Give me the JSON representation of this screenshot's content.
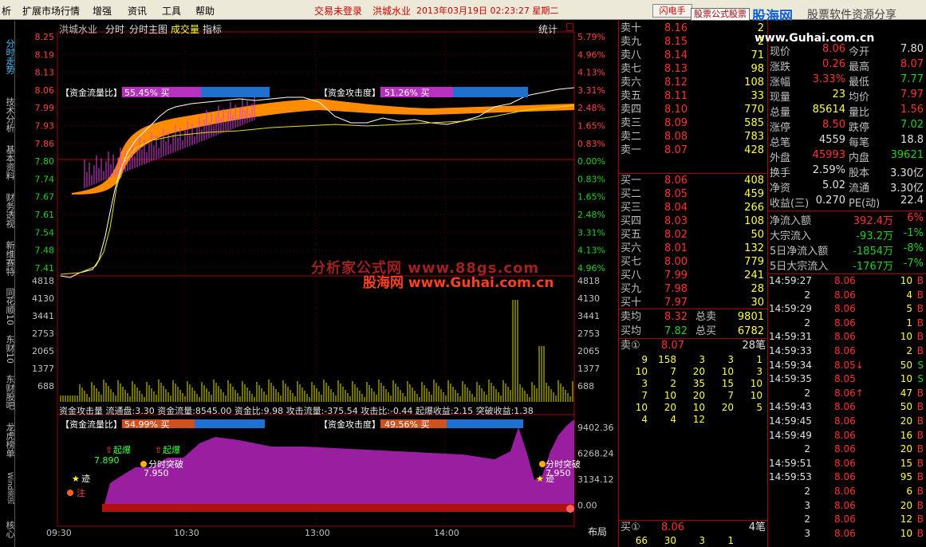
{
  "menu": {
    "items": [
      "析",
      "扩展市场行情",
      "增强",
      "资讯",
      "工具",
      "帮助"
    ],
    "login_status": "交易未登录",
    "title_stock": "洪城水业",
    "title_datetime": "2013年03月19日  02:23:27  星期二",
    "flash_button": "闪电手",
    "brand_box": "股票公式股票",
    "brand_logo": "股海网",
    "brand_slogan": "股票软件资源分享",
    "brand_url": "www.Guhai.com.cn"
  },
  "left_tabs": [
    "分时走势",
    "技术分析",
    "基本资料",
    "财务透视",
    "新维赛特",
    "同花顺10",
    "东财10",
    "东财股吧",
    "龙虎榜单",
    "Wind资讯",
    "核心"
  ],
  "chart_header": {
    "stock_name": "洪城水业",
    "tabs": [
      "分时",
      "分时主图",
      "成交量",
      "指标"
    ],
    "stats": "统计"
  },
  "price_axis": {
    "left": [
      "8.25",
      "8.19",
      "8.13",
      "8.06",
      "7.99",
      "7.93",
      "7.86",
      "7.80",
      "7.74",
      "7.67",
      "7.61",
      "7.54",
      "7.48",
      "7.41"
    ],
    "right": [
      "5.79%",
      "4.96%",
      "4.13%",
      "3.31%",
      "2.48%",
      "1.65%",
      "0.83%",
      "0.00%",
      "0.83%",
      "1.65%",
      "2.48%",
      "3.31%",
      "4.13%",
      "4.96%"
    ]
  },
  "volume_axis": [
    "4818",
    "4130",
    "3441",
    "2753",
    "2065",
    "1377",
    "688"
  ],
  "indicator_axis": [
    "9402.36",
    "6268.24",
    "3134.12",
    "0.00"
  ],
  "time_axis": [
    "09:30",
    "10:30",
    "13:00",
    "14:00"
  ],
  "layout_button": "布局",
  "overlays": {
    "fund_flow_label": "【资金流量比】",
    "fund_flow_value": "55.45% 买",
    "fund_attack_label": "【资金攻击度】",
    "fund_attack_value": "51.26% 买",
    "fund_flow_label2": "【资金流量比】",
    "fund_flow_value2": "54.99% 买",
    "fund_attack_label2": "【资金攻击度】",
    "fund_attack_value2": "49.56% 买",
    "indicator_line": "资金攻击量  流通盘:3.30  资金流量:8545.00  资金比:9.98  攻击流量:-375.54  攻击比:-0.44  起爆收益:2.15  突破收益:1.38",
    "signal_qibao": "起爆",
    "signal_qibao_val": "7.890",
    "signal_break": "分时突破",
    "signal_break_val": "7.950",
    "signal_break2": "分时突破",
    "signal_break2_val": "7.950",
    "signal_ji": "迹",
    "signal_zhu": "注"
  },
  "watermark": {
    "line1": "分析家公式网 www.88gs.com",
    "line2": "股海网  www.Guhai.com.cn"
  },
  "order_book": {
    "asks": [
      {
        "label": "卖十",
        "price": "8.16",
        "vol": "2"
      },
      {
        "label": "卖九",
        "price": "8.15",
        "vol": "2"
      },
      {
        "label": "卖八",
        "price": "8.14",
        "vol": "71"
      },
      {
        "label": "卖七",
        "price": "8.13",
        "vol": "98"
      },
      {
        "label": "卖六",
        "price": "8.12",
        "vol": "108"
      },
      {
        "label": "卖五",
        "price": "8.11",
        "vol": "33"
      },
      {
        "label": "卖四",
        "price": "8.10",
        "vol": "770"
      },
      {
        "label": "卖三",
        "price": "8.09",
        "vol": "585"
      },
      {
        "label": "卖二",
        "price": "8.08",
        "vol": "783"
      },
      {
        "label": "卖一",
        "price": "8.07",
        "vol": "428"
      }
    ],
    "bids": [
      {
        "label": "买一",
        "price": "8.06",
        "vol": "408"
      },
      {
        "label": "买二",
        "price": "8.05",
        "vol": "459"
      },
      {
        "label": "买三",
        "price": "8.04",
        "vol": "266"
      },
      {
        "label": "买四",
        "price": "8.03",
        "vol": "108"
      },
      {
        "label": "买五",
        "price": "8.02",
        "vol": "50"
      },
      {
        "label": "买六",
        "price": "8.01",
        "vol": "132"
      },
      {
        "label": "买七",
        "price": "8.00",
        "vol": "779"
      },
      {
        "label": "买八",
        "price": "7.99",
        "vol": "241"
      },
      {
        "label": "买九",
        "price": "7.98",
        "vol": "28"
      },
      {
        "label": "买十",
        "price": "7.97",
        "vol": "30"
      }
    ],
    "avg_ask_label": "卖均",
    "avg_ask": "8.32",
    "total_ask_label": "总卖",
    "total_ask": "9801",
    "avg_bid_label": "买均",
    "avg_bid": "7.82",
    "total_bid_label": "总买",
    "total_bid": "6782",
    "queue_label": "卖①",
    "queue_price": "8.07",
    "queue_count": "28笔",
    "queue_rows": [
      [
        "9",
        "158",
        "3",
        "3",
        "1"
      ],
      [
        "10",
        "7",
        "20",
        "10",
        "3"
      ],
      [
        "3",
        "2",
        "35",
        "15",
        "10"
      ],
      [
        "7",
        "10",
        "20",
        "7",
        "10"
      ],
      [
        "10",
        "20",
        "10",
        "20",
        "5"
      ],
      [
        "4",
        "4",
        "12",
        "",
        ""
      ]
    ],
    "bid_queue_label": "买①",
    "bid_queue_price": "8.06",
    "bid_queue_count": "4笔",
    "bid_queue_row": [
      "66",
      "30",
      "3",
      "1"
    ]
  },
  "quote": {
    "rows": [
      [
        {
          "l": "现价",
          "v": "8.06",
          "c": "red"
        },
        {
          "l": "今开",
          "v": "7.80",
          "c": "wht"
        }
      ],
      [
        {
          "l": "涨跌",
          "v": "0.26",
          "c": "red"
        },
        {
          "l": "最高",
          "v": "8.07",
          "c": "red"
        }
      ],
      [
        {
          "l": "涨幅",
          "v": "3.33%",
          "c": "red"
        },
        {
          "l": "最低",
          "v": "7.77",
          "c": "grn"
        }
      ],
      [
        {
          "l": "现量",
          "v": "23",
          "c": "yel"
        },
        {
          "l": "均价",
          "v": "7.97",
          "c": "red"
        }
      ],
      [
        {
          "l": "总量",
          "v": "85614",
          "c": "yel"
        },
        {
          "l": "量比",
          "v": "1.56",
          "c": "red"
        }
      ],
      [
        {
          "l": "涨停",
          "v": "8.50",
          "c": "red"
        },
        {
          "l": "跌停",
          "v": "7.02",
          "c": "grn"
        }
      ],
      [
        {
          "l": "总笔",
          "v": "4559",
          "c": "wht"
        },
        {
          "l": "每笔",
          "v": "18.8",
          "c": "wht"
        }
      ],
      [
        {
          "l": "外盘",
          "v": "45993",
          "c": "red"
        },
        {
          "l": "内盘",
          "v": "39621",
          "c": "grn"
        }
      ],
      [
        {
          "l": "换手",
          "v": "2.59%",
          "c": "wht"
        },
        {
          "l": "股本",
          "v": "3.30亿",
          "c": "wht"
        }
      ],
      [
        {
          "l": "净资",
          "v": "5.02",
          "c": "wht"
        },
        {
          "l": "流通",
          "v": "3.30亿",
          "c": "wht"
        }
      ],
      [
        {
          "l": "收益(三)",
          "v": "0.270",
          "c": "wht"
        },
        {
          "l": "PE(动)",
          "v": "22.4",
          "c": "wht"
        }
      ]
    ],
    "flows": [
      {
        "l": "净流入额",
        "v": "392.4万",
        "p": "6%",
        "c": "red"
      },
      {
        "l": "大宗流入",
        "v": "-93.2万",
        "p": "-1%",
        "c": "grn"
      },
      {
        "l": "5日净流入额",
        "v": "-1854万",
        "p": "-8%",
        "c": "grn"
      },
      {
        "l": "5日大宗流入",
        "v": "-1767万",
        "p": "-7%",
        "c": "grn"
      }
    ]
  },
  "ticks": [
    {
      "t": "14:59:27",
      "p": "8.06",
      "v": "10",
      "s": "B"
    },
    {
      "t": "2",
      "p": "8.06",
      "v": "4",
      "s": "B"
    },
    {
      "t": "14:59:29",
      "p": "8.06",
      "v": "5",
      "s": "B"
    },
    {
      "t": "2",
      "p": "8.06",
      "v": "1",
      "s": "B"
    },
    {
      "t": "14:59:31",
      "p": "8.06",
      "v": "10",
      "s": "B"
    },
    {
      "t": "14:59:33",
      "p": "8.06",
      "v": "2",
      "s": "B"
    },
    {
      "t": "14:59:34",
      "p": "8.05↓",
      "v": "50",
      "s": "S"
    },
    {
      "t": "14:59:35",
      "p": "8.05",
      "v": "10",
      "s": "S"
    },
    {
      "t": "2",
      "p": "8.06↑",
      "v": "47",
      "s": "B"
    },
    {
      "t": "14:59:43",
      "p": "8.06",
      "v": "50",
      "s": "B"
    },
    {
      "t": "14:59:45",
      "p": "8.06",
      "v": "20",
      "s": "B"
    },
    {
      "t": "14:59:49",
      "p": "8.06",
      "v": "16",
      "s": "B"
    },
    {
      "t": "2",
      "p": "8.06",
      "v": "20",
      "s": "B"
    },
    {
      "t": "14:59:51",
      "p": "8.06",
      "v": "15",
      "s": "B"
    },
    {
      "t": "14:59:53",
      "p": "8.06",
      "v": "95",
      "s": "B"
    },
    {
      "t": "2",
      "p": "8.06",
      "v": "6",
      "s": "B"
    },
    {
      "t": "3",
      "p": "8.06",
      "v": "20",
      "s": "B"
    },
    {
      "t": "2",
      "p": "8.06",
      "v": "12",
      "s": "B"
    },
    {
      "t": "3",
      "p": "8.06",
      "v": "10",
      "s": "B"
    }
  ],
  "colors": {
    "up": "#ff3030",
    "down": "#20d020",
    "axis_red": "#a00000",
    "fund_band": "#ff8c00",
    "indicator_fill": "#9a1fa0"
  }
}
